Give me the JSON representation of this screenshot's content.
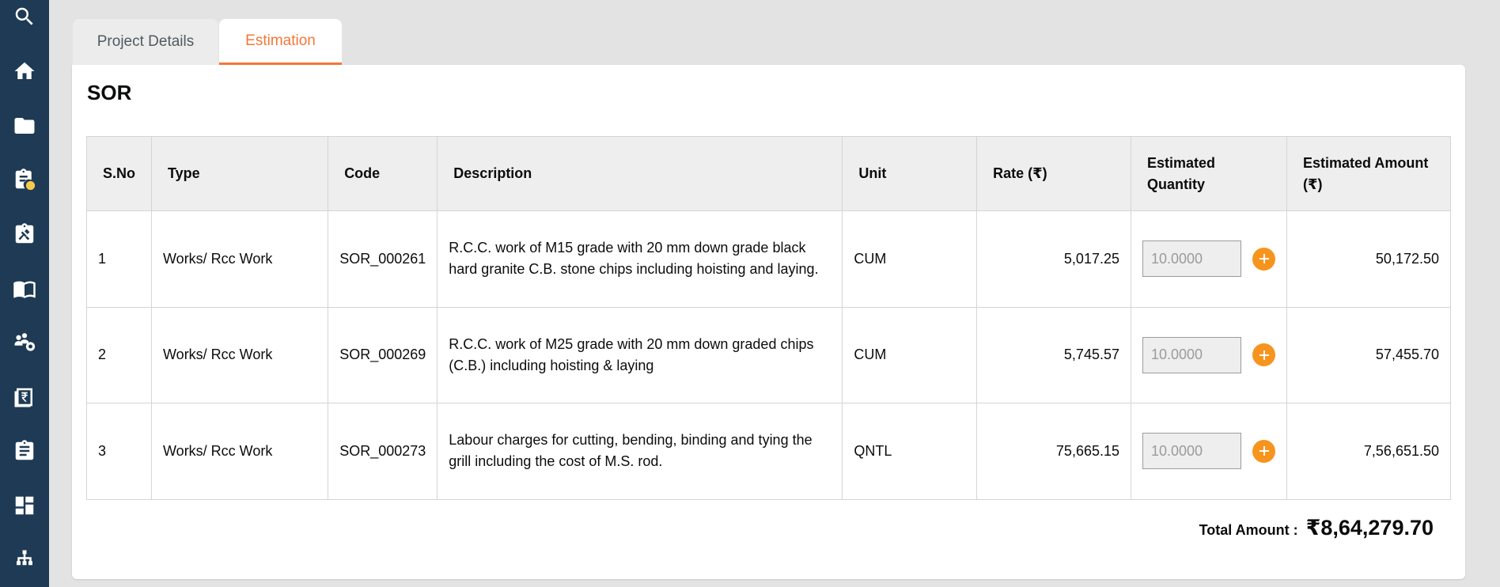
{
  "sidebar": {
    "icons": [
      "search-icon",
      "home-icon",
      "folder-icon",
      "clipboard-rupee-icon",
      "tools-clipboard-icon",
      "book-icon",
      "people-settings-icon",
      "rupee-receipt-icon",
      "assignment-icon",
      "dashboard-icon",
      "hierarchy-icon"
    ],
    "background": "#1e3a54"
  },
  "tabs": [
    {
      "label": "Project Details",
      "active": false
    },
    {
      "label": "Estimation",
      "active": true
    }
  ],
  "accent_color": "#f47738",
  "section_title": "SOR",
  "table": {
    "headers": {
      "sno": "S.No",
      "type": "Type",
      "code": "Code",
      "description": "Description",
      "unit": "Unit",
      "rate": "Rate (₹)",
      "qty": "Estimated Quantity",
      "amount": "Estimated Amount (₹)"
    },
    "rows": [
      {
        "sno": "1",
        "type": "Works/ Rcc Work",
        "code": "SOR_000261",
        "description": "R.C.C. work of M15 grade with 20 mm down grade black hard granite C.B. stone chips including hoisting and laying.",
        "unit": "CUM",
        "rate": "5,017.25",
        "qty": "10.0000",
        "amount": "50,172.50"
      },
      {
        "sno": "2",
        "type": "Works/ Rcc Work",
        "code": "SOR_000269",
        "description": "R.C.C. work of M25 grade with 20 mm down graded chips (C.B.) including hoisting & laying",
        "unit": "CUM",
        "rate": "5,745.57",
        "qty": "10.0000",
        "amount": "57,455.70"
      },
      {
        "sno": "3",
        "type": "Works/ Rcc Work",
        "code": "SOR_000273",
        "description": "Labour charges for cutting, bending, binding and tying the grill including the cost of M.S. rod.",
        "unit": "QNTL",
        "rate": "75,665.15",
        "qty": "10.0000",
        "amount": "7,56,651.50"
      }
    ]
  },
  "total": {
    "label": "Total Amount :",
    "value": "₹8,64,279.70"
  }
}
